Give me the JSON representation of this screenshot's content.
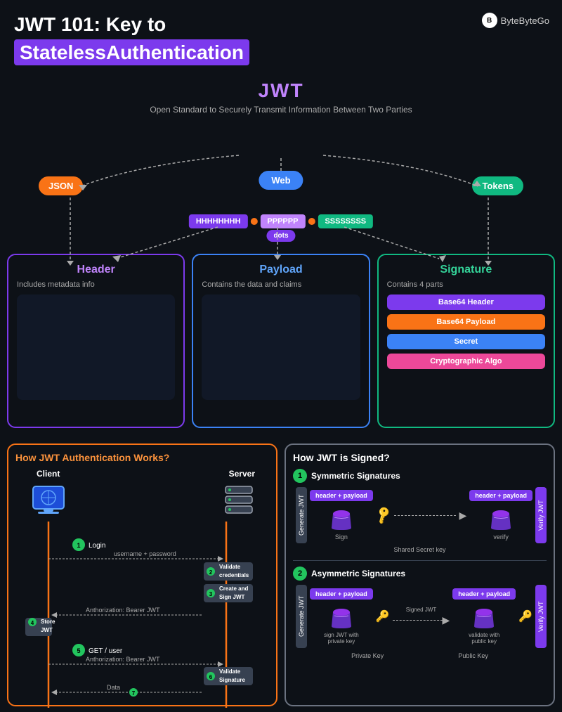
{
  "logo": {
    "text": "ByteByteGo",
    "icon": "B"
  },
  "header": {
    "line1": "JWT 101: Key to",
    "line2": "StatelessAuthentication"
  },
  "jwt": {
    "title": "JWT",
    "subtitle": "Open Standard to Securely Transmit Information Between Two Parties",
    "badges": {
      "json": "JSON",
      "web": "Web",
      "tokens": "Tokens"
    },
    "token_parts": {
      "header": "HHHHHHHH",
      "payload": "PPPPPP",
      "signature": "SSSSSSSS",
      "dots": "dots"
    }
  },
  "boxes": {
    "header": {
      "title": "Header",
      "desc": "Includes metadata info"
    },
    "payload": {
      "title": "Payload",
      "desc": "Contains the data and claims"
    },
    "signature": {
      "title": "Signature",
      "desc": "Contains 4 parts",
      "parts": [
        "Base64 Header",
        "Base64 Payload",
        "Secret",
        "Cryptographic Algo"
      ]
    }
  },
  "auth_panel": {
    "title": "How JWT Authentication Works?",
    "client": "Client",
    "server": "Server",
    "steps": [
      {
        "num": "1",
        "label": "Login"
      },
      {
        "num": "2",
        "label": "Validate\ncredentials"
      },
      {
        "num": "3",
        "label": "Create and\nSign JWT"
      },
      {
        "num": "4",
        "label": "Store\nJWT"
      },
      {
        "num": "5",
        "label": "GET / user"
      },
      {
        "num": "6",
        "label": "Validate\nSignature"
      },
      {
        "num": "7",
        "label": "Data"
      }
    ],
    "messages": [
      "username + password",
      "Anthorization: Bearer JWT",
      "Anthorization: Bearer JWT",
      "Data"
    ]
  },
  "sign_panel": {
    "title": "How JWT is Signed?",
    "symmetric": {
      "num": "1",
      "label": "Symmetric Signatures",
      "hp_left": "header + payload",
      "hp_right": "header + payload",
      "sign_label": "Sign",
      "verify_label": "verify",
      "shared_secret": "Shared Secret key",
      "generate": "Generate JWT",
      "verify_jwt": "Verify JWT"
    },
    "asymmetric": {
      "num": "2",
      "label": "Asymmetric Signatures",
      "hp_left": "header + payload",
      "hp_right": "header + payload",
      "signed_jwt": "Signed JWT",
      "sign_label": "sign JWT with\nprivate key",
      "validate_label": "validate with\npublic key",
      "private_key": "Private Key",
      "public_key": "Public Key",
      "generate": "Generate JWT",
      "verify_jwt": "Verify JWT"
    }
  }
}
